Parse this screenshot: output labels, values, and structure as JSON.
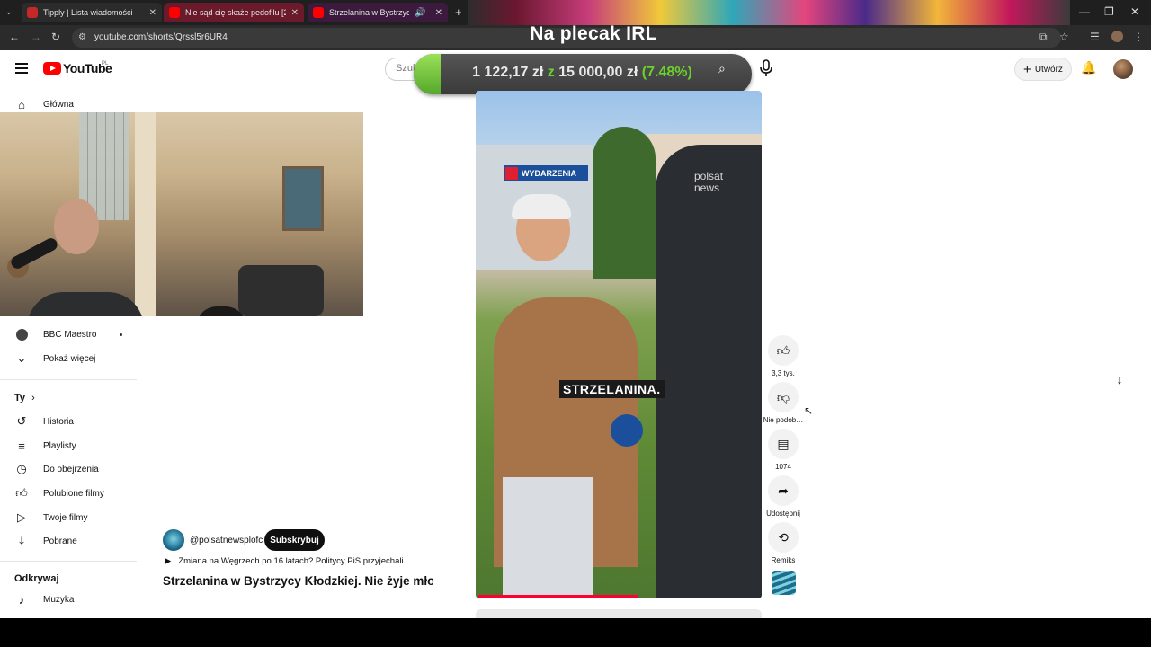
{
  "browser": {
    "tabs": [
      {
        "label": "Tipply | Lista wiadomości",
        "favicon_color": "#c62828",
        "active": false
      },
      {
        "label": "Nie sąd cię skaże pedofilu [2/3",
        "favicon_color": "#ff0000",
        "active": false
      },
      {
        "label": "Strzelanina w Bystrzycy Kłodz",
        "favicon_color": "#ff0000",
        "active": true
      }
    ],
    "url": "youtube.com/shorts/Qrssl5r6UR4"
  },
  "overlay": {
    "title": "Na plecak IRL",
    "donation": {
      "current": "1 122,17 zł",
      "sep": "z",
      "goal": "15 000,00 zł",
      "percent": "(7.48%)",
      "progress": 0.0748
    }
  },
  "header": {
    "logo_word": "YouTube",
    "logo_region": "PL",
    "search_placeholder": "Szuk",
    "create_label": "Utwórz"
  },
  "sidebar": {
    "home": "Główna",
    "bbc": "BBC Maestro",
    "show_more": "Pokaż więcej",
    "you_heading": "Ty",
    "you_items": [
      "Historia",
      "Playlisty",
      "Do obejrzenia",
      "Polubione filmy",
      "Twoje filmy",
      "Pobrane"
    ],
    "explore_heading": "Odkrywaj",
    "explore_items": [
      "Muzyka"
    ]
  },
  "video": {
    "badge": "WYDARZENIA",
    "caption": "STRZELANINA.",
    "watermark": "polsat news",
    "channel": "@polsatnewsplofc",
    "subscribe": "Subskrybuj",
    "related": "Zmiana na Węgrzech po 16 latach? Politycy PiS przyjechali",
    "title": "Strzelanina w Bystrzycy Kłodzkiej. Nie żyje mło…",
    "progress": 0.57
  },
  "actions": {
    "like_count": "3,3 tys.",
    "dislike_label": "Nie podob…",
    "comments_count": "1074",
    "share_label": "Udostępnij",
    "remix_label": "Remiks"
  },
  "colors": {
    "accent": "#ff0000",
    "progress": "#ff0033",
    "donation_green": "#6bd22b"
  }
}
